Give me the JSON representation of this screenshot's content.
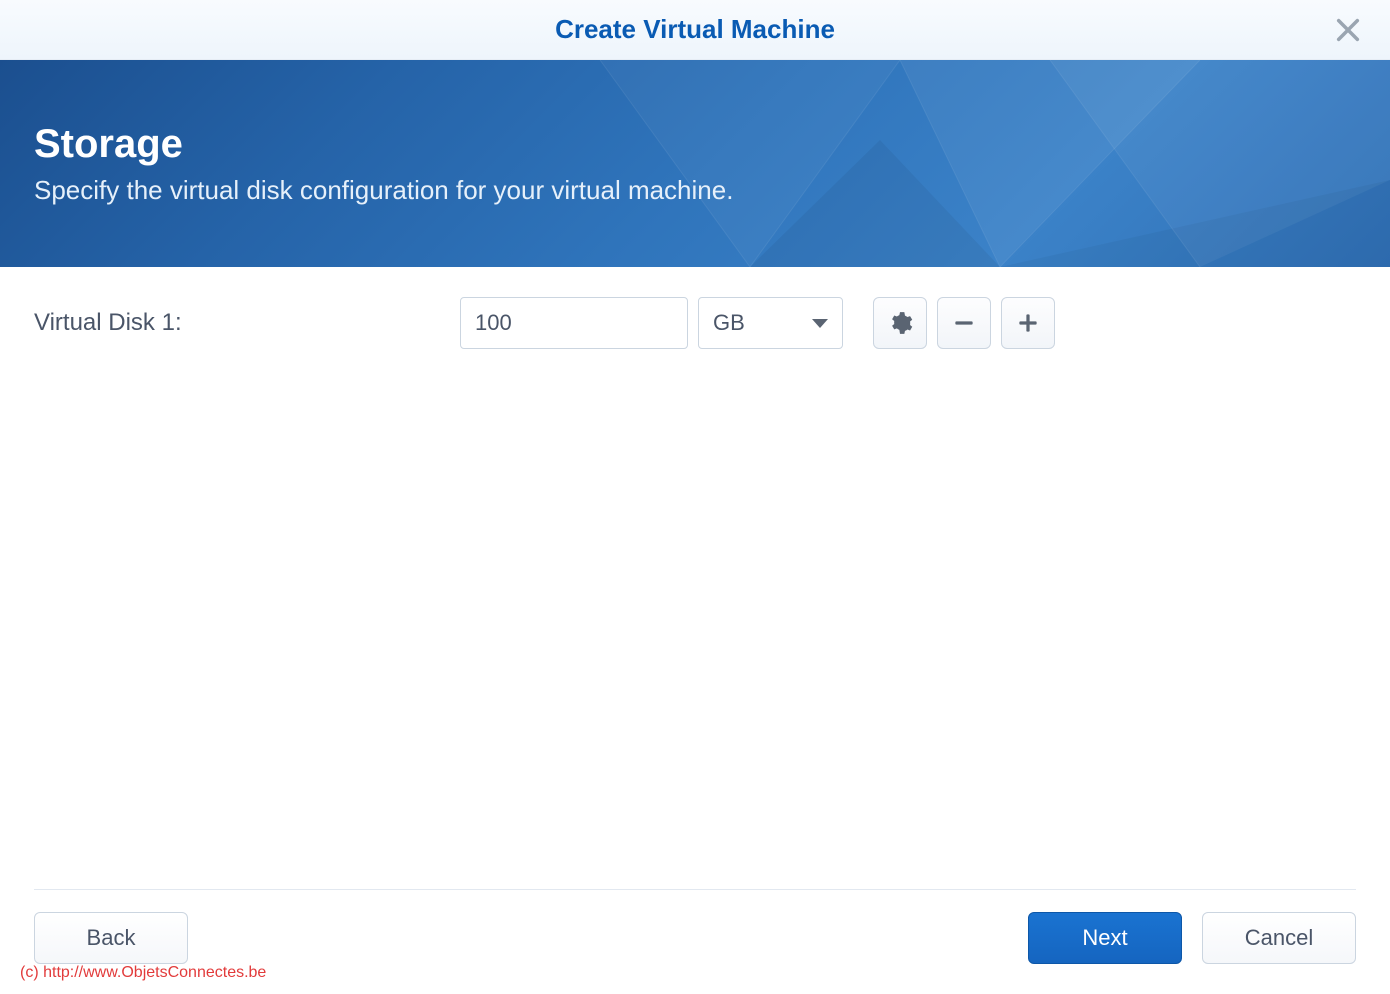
{
  "titlebar": {
    "title": "Create Virtual Machine"
  },
  "banner": {
    "title": "Storage",
    "subtitle": "Specify the virtual disk configuration for your virtual machine."
  },
  "form": {
    "disk_label": "Virtual Disk 1:",
    "disk_size_value": "100",
    "disk_unit_selected": "GB"
  },
  "footer": {
    "back_label": "Back",
    "next_label": "Next",
    "cancel_label": "Cancel"
  },
  "watermark": "(c) http://www.ObjetsConnectes.be"
}
